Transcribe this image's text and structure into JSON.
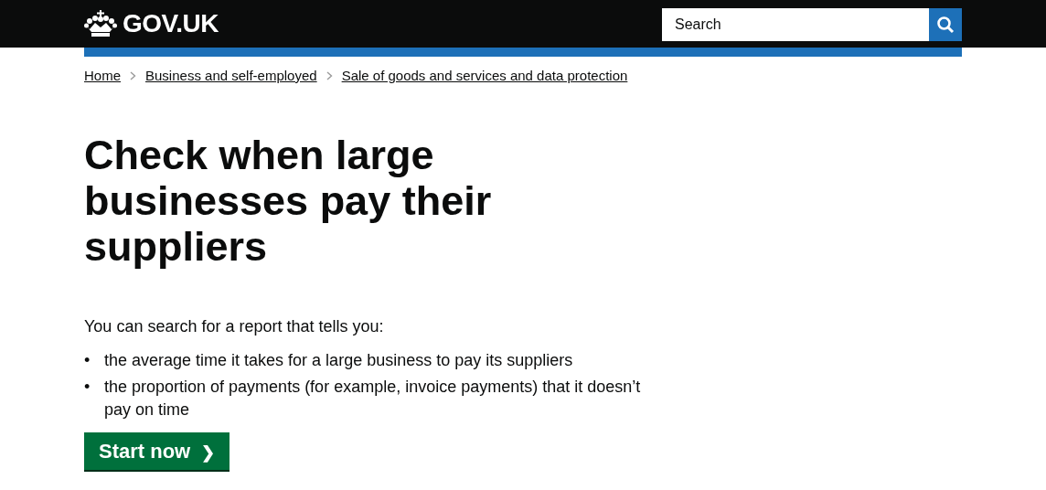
{
  "header": {
    "logo": "GOV.UK",
    "search": {
      "placeholder": "Search"
    }
  },
  "breadcrumbs": [
    "Home",
    "Business and self-employed",
    "Sale of goods and services and data protection"
  ],
  "title": "Check when large businesses pay their suppliers",
  "intro": "You can search for a report that tells you:",
  "bullets": [
    {
      "marker": "•",
      "text": "the average time it takes for a large business to pay its suppliers"
    },
    {
      "marker": "•",
      "text": "the proportion of payments (for example, invoice payments) that it doesn’t pay on time"
    }
  ],
  "start_button": {
    "label": "Start now",
    "arrow": "❯"
  }
}
